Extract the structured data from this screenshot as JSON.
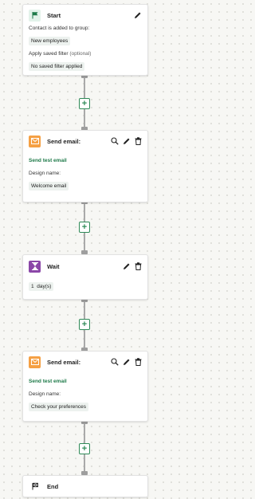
{
  "steps": {
    "start": {
      "title": "Start",
      "trigger_label": "Contact is added to group:",
      "trigger_value": "New employees",
      "filter_label": "Apply saved filter",
      "filter_optional": "(optional)",
      "filter_value": "No saved filter applied"
    },
    "email1": {
      "title": "Send email:",
      "test_link": "Send test email",
      "design_label": "Design name:",
      "design_value": "Welcome email"
    },
    "wait": {
      "title": "Wait",
      "amount": "1",
      "unit": "day(s)"
    },
    "email2": {
      "title": "Send email:",
      "test_link": "Send test email",
      "design_label": "Design name:",
      "design_value": "Check your preferences"
    },
    "end": {
      "title": "End"
    }
  },
  "add_step_label": "+",
  "icons": {
    "start": "green-flag-icon",
    "email": "envelope-icon",
    "wait": "hourglass-icon",
    "end": "checkered-flag-icon",
    "edit": "pencil-icon",
    "delete": "trash-icon",
    "preview": "magnifier-icon"
  },
  "colors": {
    "start_badge": "#e3f3ea",
    "email_badge": "#f5a044",
    "wait_badge": "#8b47a8",
    "accent_green": "#2e8a57",
    "link_green": "#1e7a49"
  }
}
